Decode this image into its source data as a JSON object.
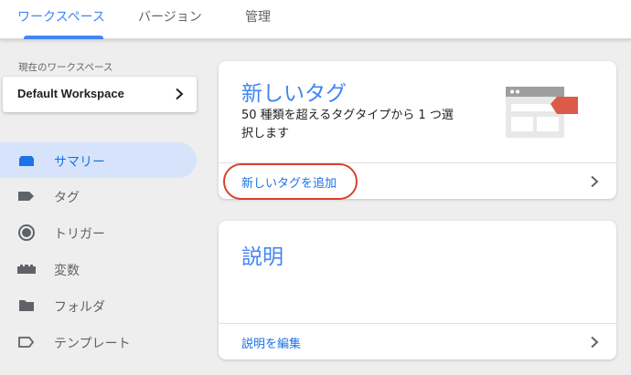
{
  "tabs": [
    {
      "label": "ワークスペース",
      "active": true
    },
    {
      "label": "バージョン",
      "active": false
    },
    {
      "label": "管理",
      "active": false
    }
  ],
  "workspace": {
    "caption": "現在のワークスペース",
    "name": "Default Workspace"
  },
  "nav": [
    {
      "label": "サマリー",
      "icon": "summary-icon",
      "active": true
    },
    {
      "label": "タグ",
      "icon": "tag-icon",
      "active": false
    },
    {
      "label": "トリガー",
      "icon": "trigger-icon",
      "active": false
    },
    {
      "label": "変数",
      "icon": "variable-icon",
      "active": false
    },
    {
      "label": "フォルダ",
      "icon": "folder-icon",
      "active": false
    },
    {
      "label": "テンプレート",
      "icon": "template-icon",
      "active": false
    }
  ],
  "new_tag_card": {
    "title": "新しいタグ",
    "description": "50 種類を超えるタグタイプから 1 つ選択します",
    "action": "新しいタグを追加"
  },
  "description_card": {
    "title": "説明",
    "action": "説明を編集"
  },
  "colors": {
    "accent": "#4285f4",
    "active_nav_bg": "#d7e3fa",
    "highlight": "#d9412e",
    "tag_red": "#db5a4a"
  }
}
